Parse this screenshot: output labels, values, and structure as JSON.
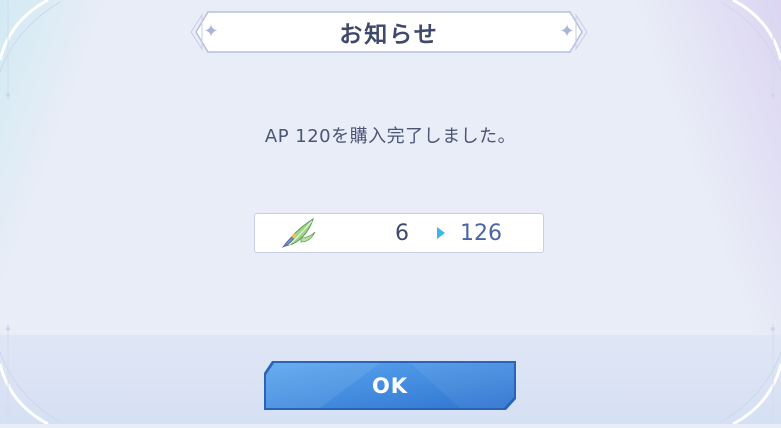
{
  "dialog": {
    "title": "お知らせ",
    "message": "AP 120を購入完了しました。"
  },
  "result": {
    "item_icon": "ap-feather-icon",
    "from_value": "6",
    "to_value": "126"
  },
  "ok_button": {
    "label": "OK"
  },
  "colors": {
    "background": "#e9edf7",
    "text_primary": "#3f4a6b",
    "arrow": "#3bb6e6",
    "button": "#3d86dd"
  }
}
